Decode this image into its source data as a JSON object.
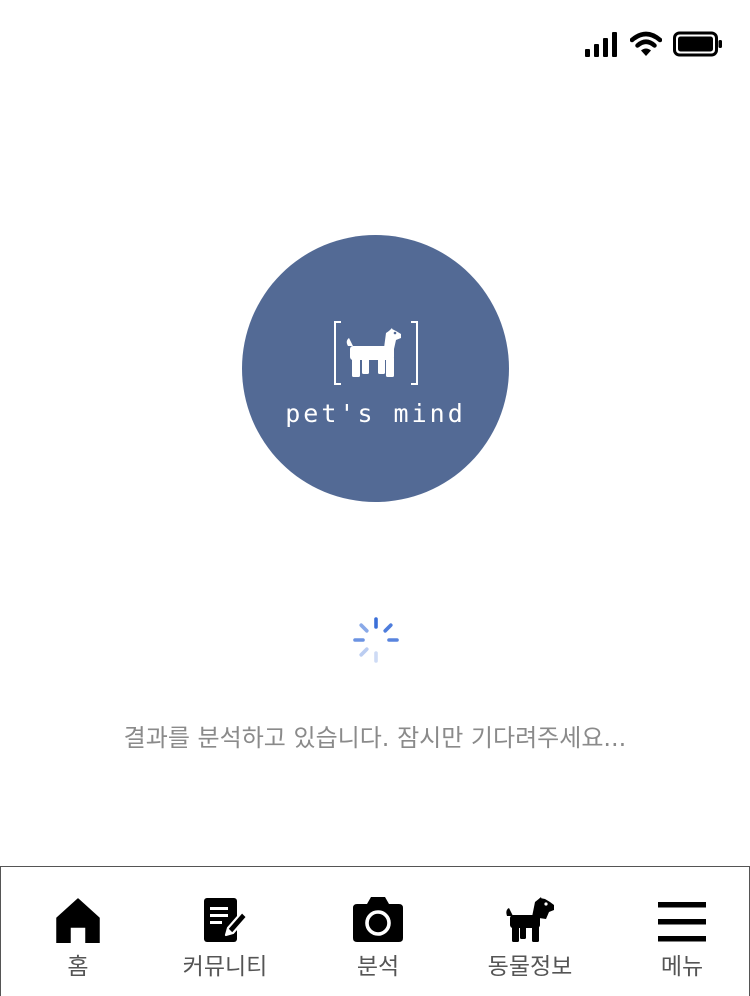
{
  "status_bar": {
    "signal_icon": "cellular-signal-icon",
    "wifi_icon": "wifi-icon",
    "battery_icon": "battery-full-icon"
  },
  "logo": {
    "text": "pet's mind",
    "icon": "dog-in-brackets-icon",
    "circle_color": "#536A95"
  },
  "loading": {
    "spinner_icon": "loading-spinner-icon",
    "spinner_color": "#3B6FD8",
    "message": "결과를 분석하고 있습니다. 잠시만 기다려주세요..."
  },
  "tab_bar": {
    "tabs": [
      {
        "label": "홈",
        "icon": "home-icon"
      },
      {
        "label": "커뮤니티",
        "icon": "document-edit-icon"
      },
      {
        "label": "분석",
        "icon": "camera-icon"
      },
      {
        "label": "동물정보",
        "icon": "dog-icon"
      },
      {
        "label": "메뉴",
        "icon": "hamburger-menu-icon"
      }
    ]
  }
}
